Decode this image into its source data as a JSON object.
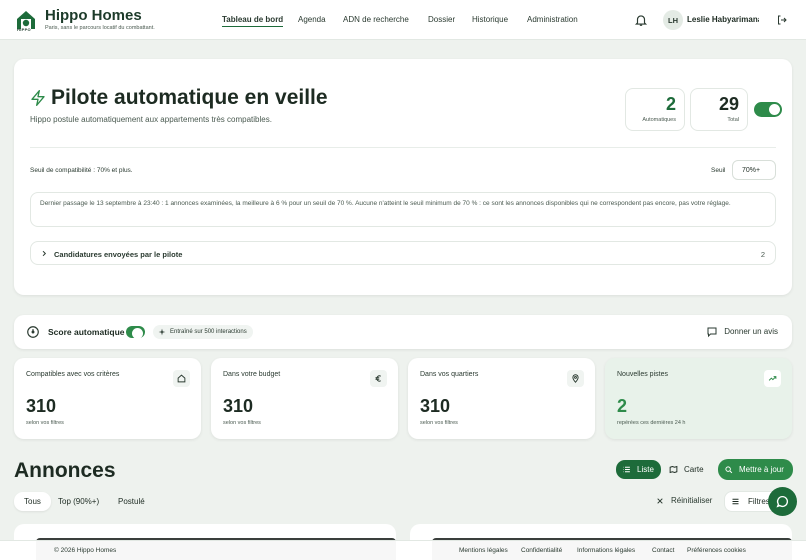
{
  "header": {
    "brand": "Hippo Homes",
    "logo_word": "HIPPO",
    "tagline": "Paris, sans le parcours locatif du combattant.",
    "nav": [
      {
        "label": "Tableau de bord",
        "active": true
      },
      {
        "label": "Agenda"
      },
      {
        "label": "ADN de recherche"
      },
      {
        "label": "Dossier"
      },
      {
        "label": "Historique"
      },
      {
        "label": "Administration"
      }
    ],
    "avatar_initials": "LH",
    "user_name": "Leslie Habyarimana"
  },
  "pilot": {
    "title": "Pilote automatique en veille",
    "subtitle": "Hippo postule automatiquement aux appartements très compatibles.",
    "automatiques_count": "2",
    "automatiques_label": "Automatiques",
    "total_count": "29",
    "total_label": "Total",
    "enabled": true,
    "threshold_label": "Seuil de compatibilité : 70% et plus.",
    "threshold_control_label": "Seuil",
    "threshold_value": "70%+",
    "last_pass": "Dernier passage le 13 septembre à 23:40 : 1 annonces examinées, la meilleure à 6 % pour un seuil de 70 %. Aucune n'atteint le seuil minimum de 70 % : ce sont les annonces disponibles qui ne correspondent pas encore, pas votre réglage.",
    "candidatures_label": "Candidatures envoyées par le pilote",
    "candidatures_count": "2"
  },
  "score": {
    "label": "Score automatique",
    "enabled": true,
    "trained_pill": "Entraîné sur 500 interactions",
    "feedback_label": "Donner un avis"
  },
  "stats": [
    {
      "title": "Compatibles avec vos critères",
      "value": "310",
      "sub": "selon vos filtres",
      "icon": "home-icon"
    },
    {
      "title": "Dans votre budget",
      "value": "310",
      "sub": "selon vos filtres",
      "icon": "euro-icon"
    },
    {
      "title": "Dans vos quartiers",
      "value": "310",
      "sub": "selon vos filtres",
      "icon": "map-pin-icon"
    },
    {
      "title": "Nouvelles pistes",
      "value": "2",
      "sub": "repérées ces dernières 24 h",
      "icon": "trending-up-icon"
    }
  ],
  "annonces": {
    "title": "Annonces",
    "view_list": "Liste",
    "view_map": "Carte",
    "update_label": "Mettre à jour",
    "tabs": [
      {
        "label": "Tous",
        "active": true
      },
      {
        "label": "Top (90%+)"
      },
      {
        "label": "Postulé"
      }
    ],
    "reset_label": "Réinitialiser",
    "filters_label": "Filtres"
  },
  "footer": {
    "copyright": "© 2026 Hippo Homes",
    "links": [
      "Mentions légales",
      "Confidentialité",
      "Informations légales",
      "Contact",
      "Préférences cookies"
    ]
  },
  "colors": {
    "accent": "#2e8b4a",
    "accent_dark": "#1d6b3a",
    "background": "#eef2ee"
  }
}
